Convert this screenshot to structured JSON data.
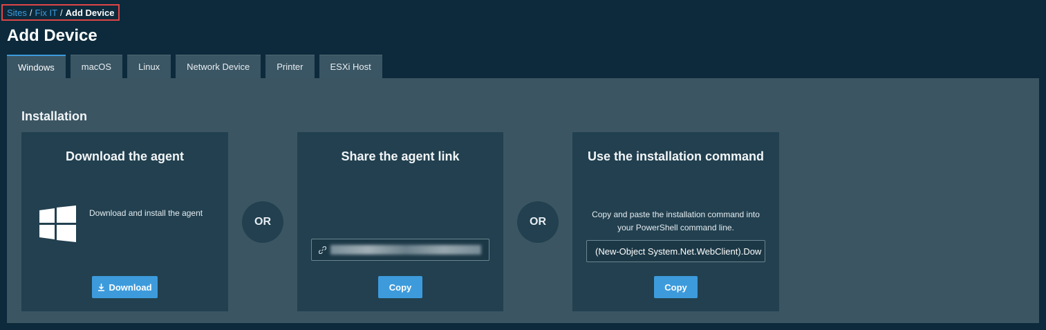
{
  "breadcrumb": {
    "items": [
      "Sites",
      "Fix IT"
    ],
    "separator": "/",
    "current": "Add Device"
  },
  "page": {
    "title": "Add Device"
  },
  "tabs": [
    {
      "label": "Windows",
      "active": true
    },
    {
      "label": "macOS"
    },
    {
      "label": "Linux"
    },
    {
      "label": "Network Device"
    },
    {
      "label": "Printer"
    },
    {
      "label": "ESXi Host"
    }
  ],
  "installation": {
    "title": "Installation",
    "or_label": "OR",
    "download_card": {
      "title": "Download the agent",
      "icon": "windows-logo-icon",
      "description": "Download and install the agent",
      "button": "Download",
      "button_icon": "download-icon"
    },
    "share_card": {
      "title": "Share the agent link",
      "link_icon": "link-icon",
      "button": "Copy"
    },
    "command_card": {
      "title": "Use the installation command",
      "description_line1": "Copy and paste the installation command into",
      "description_line2": "your PowerShell command line.",
      "command": "(New-Object System.Net.WebClient).Dow",
      "button": "Copy"
    }
  },
  "colors": {
    "background": "#0c2a3b",
    "panel": "#3b5562",
    "card": "#22404f",
    "accent": "#3d9bdc",
    "highlight_border": "#e04545"
  }
}
